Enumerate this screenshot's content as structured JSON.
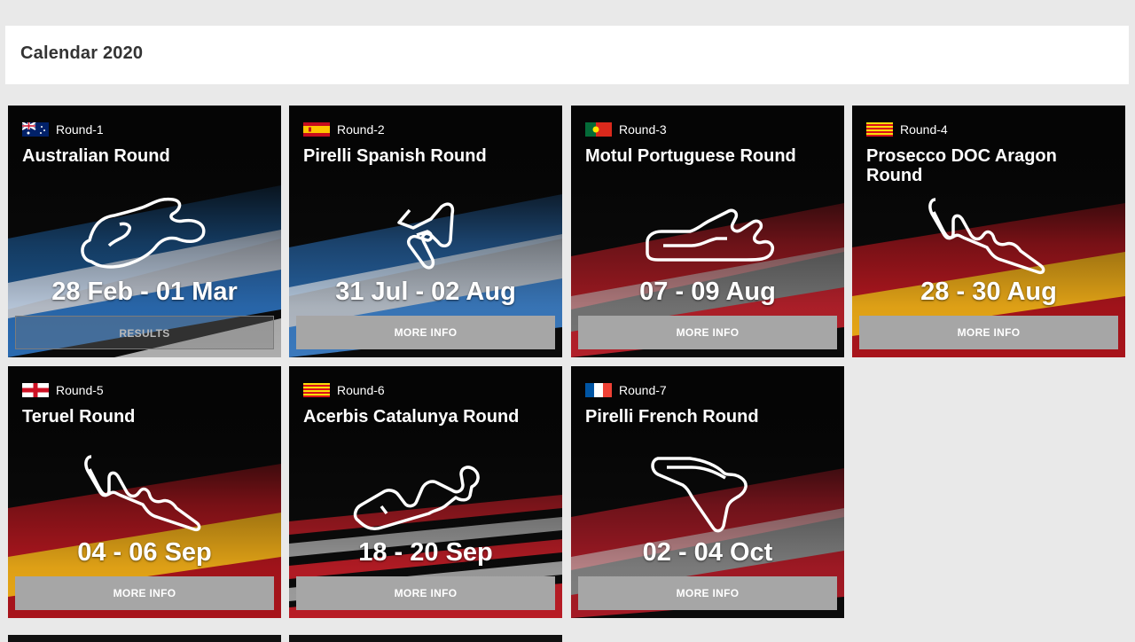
{
  "header": {
    "title": "Calendar 2020"
  },
  "rounds": [
    {
      "round": "Round-1",
      "name": "Australian Round",
      "dates": "28 Feb - 01 Mar",
      "button": "RESULTS",
      "flag": "australia-flag-icon",
      "track": "phillip-island-track-icon",
      "colors": [
        "#1a4f86",
        "#ffffff"
      ]
    },
    {
      "round": "Round-2",
      "name": "Pirelli Spanish Round",
      "dates": "31 Jul - 02 Aug",
      "button": "MORE INFO",
      "flag": "spain-flag-icon",
      "track": "jerez-track-icon",
      "colors": [
        "#2a6aa8",
        "#dfe8f3"
      ]
    },
    {
      "round": "Round-3",
      "name": "Motul Portuguese Round",
      "dates": "07 - 09 Aug",
      "button": "MORE INFO",
      "flag": "portugal-flag-icon",
      "track": "portimao-track-icon",
      "colors": [
        "#c8202a",
        "#c9c9c9"
      ]
    },
    {
      "round": "Round-4",
      "name": "Prosecco DOC Aragon Round",
      "dates": "28 - 30 Aug",
      "button": "MORE INFO",
      "flag": "aragon-flag-icon",
      "track": "aragon-track-icon",
      "colors": [
        "#c2171f",
        "#f2b519"
      ]
    },
    {
      "round": "Round-5",
      "name": "Teruel Round",
      "dates": "04 - 06 Sep",
      "button": "MORE INFO",
      "flag": "england-flag-icon",
      "track": "aragon-track-icon",
      "colors": [
        "#c2171f",
        "#f2b519"
      ]
    },
    {
      "round": "Round-6",
      "name": "Acerbis Catalunya Round",
      "dates": "18 - 20 Sep",
      "button": "MORE INFO",
      "flag": "catalonia-flag-icon",
      "track": "catalunya-track-icon",
      "colors": [
        "#b81c25",
        "#e0e0e0"
      ]
    },
    {
      "round": "Round-7",
      "name": "Pirelli French Round",
      "dates": "02 - 04 Oct",
      "button": "MORE INFO",
      "flag": "france-flag-icon",
      "track": "magny-cours-track-icon",
      "colors": [
        "#b51c2a",
        "#d8d8d8"
      ]
    }
  ]
}
